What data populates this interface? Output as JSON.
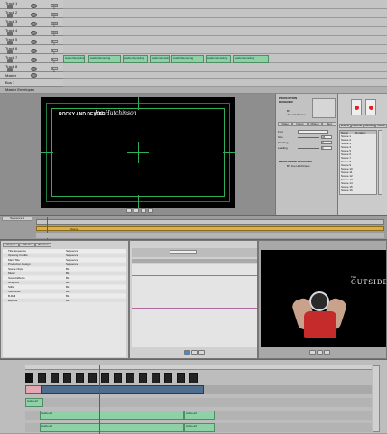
{
  "top_timeline": {
    "tracks": [
      {
        "name": "Track 1"
      },
      {
        "name": "Track 2"
      },
      {
        "name": "Track 3"
      },
      {
        "name": "Track 4"
      },
      {
        "name": "Track 5"
      },
      {
        "name": "Track 6"
      },
      {
        "name": "Track 7"
      },
      {
        "name": "Track 8"
      }
    ],
    "bus_label": "Master",
    "chip_label": "Bus 1",
    "section_label": "Master Envelopes",
    "clip_label": "Audio Recording"
  },
  "viewer": {
    "overlay_text": "ROCKY AND DEXTER",
    "signature_text": "Joe Hutchinson"
  },
  "inspector": {
    "title_line1": "PRODUCTION",
    "title_line2": "DESIGNER",
    "name_label": "BY",
    "name_value": "Joe Hutchinson",
    "tabs": [
      "Video",
      "Filters",
      "Motion",
      "Text"
    ],
    "props": [
      {
        "label": "Font",
        "value": ""
      },
      {
        "label": "Size",
        "value": "36"
      },
      {
        "label": "Tracking",
        "value": "0"
      },
      {
        "label": "Leading",
        "value": "0"
      }
    ],
    "footer_line1": "PRODUCTION DESIGNER",
    "footer_line2": "BY Joe Hutchinson"
  },
  "browser_right": {
    "tabs": [
      "Effects",
      "Browser",
      "Markers",
      "Media"
    ],
    "header": [
      "Name",
      "Duration"
    ],
    "rows": [
      "Scene 1",
      "Scene 2",
      "Scene 3",
      "Scene 4",
      "Scene 5",
      "Scene 6",
      "Scene 7",
      "Scene 8",
      "Scene 9",
      "Scene 10",
      "Scene 11",
      "Scene 12",
      "Scene 13",
      "Scene 14",
      "Scene 15",
      "Scene 16"
    ]
  },
  "mid_strip": {
    "label": "Sequence 1",
    "marker_label": "Scene"
  },
  "bottom_browser": {
    "tabs": [
      "Project",
      "Effects",
      "Browser"
    ],
    "rows": [
      {
        "name": "Title Sequence",
        "type": "Sequence"
      },
      {
        "name": "Opening Credits",
        "type": "Sequence"
      },
      {
        "name": "Main Title",
        "type": "Sequence"
      },
      {
        "name": "Production Design",
        "type": "Sequence"
      },
      {
        "name": "Scene Clips",
        "type": "Bin"
      },
      {
        "name": "Music",
        "type": "Bin"
      },
      {
        "name": "Sound Effects",
        "type": "Bin"
      },
      {
        "name": "Graphics",
        "type": "Bin"
      },
      {
        "name": "Stills",
        "type": "Bin"
      },
      {
        "name": "Interviews",
        "type": "Bin"
      },
      {
        "name": "B-Roll",
        "type": "Bin"
      },
      {
        "name": "Exports",
        "type": "Bin"
      }
    ]
  },
  "canvas": {
    "poster_small": "THE",
    "poster_title": "OUTSIDE"
  },
  "bottom_timeline": {
    "video_clip_label": "Clip",
    "audio_clip_label": "Audio.aif"
  },
  "colors": {
    "audio_clip": "#8fd1a6",
    "playhead": "#2266cc",
    "timeline_bar": "#d9b04a",
    "viewer_guide": "#2fae5a"
  }
}
